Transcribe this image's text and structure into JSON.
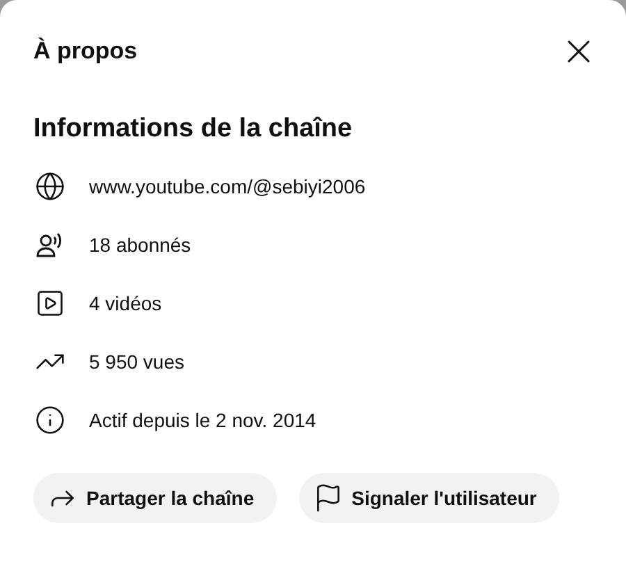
{
  "dialog": {
    "title": "À propos"
  },
  "section": {
    "heading": "Informations de la chaîne"
  },
  "details": [
    {
      "kind": "link",
      "text": "www.youtube.com/@sebiyi2006"
    },
    {
      "kind": "subscribers",
      "text": "18 abonnés"
    },
    {
      "kind": "videos",
      "text": "4 vidéos"
    },
    {
      "kind": "views",
      "text": "5 950 vues"
    },
    {
      "kind": "joined",
      "text": "Actif depuis le 2 nov. 2014"
    }
  ],
  "buttons": [
    {
      "kind": "share",
      "label": "Partager la chaîne"
    },
    {
      "kind": "report",
      "label": "Signaler l'utilisateur"
    }
  ]
}
